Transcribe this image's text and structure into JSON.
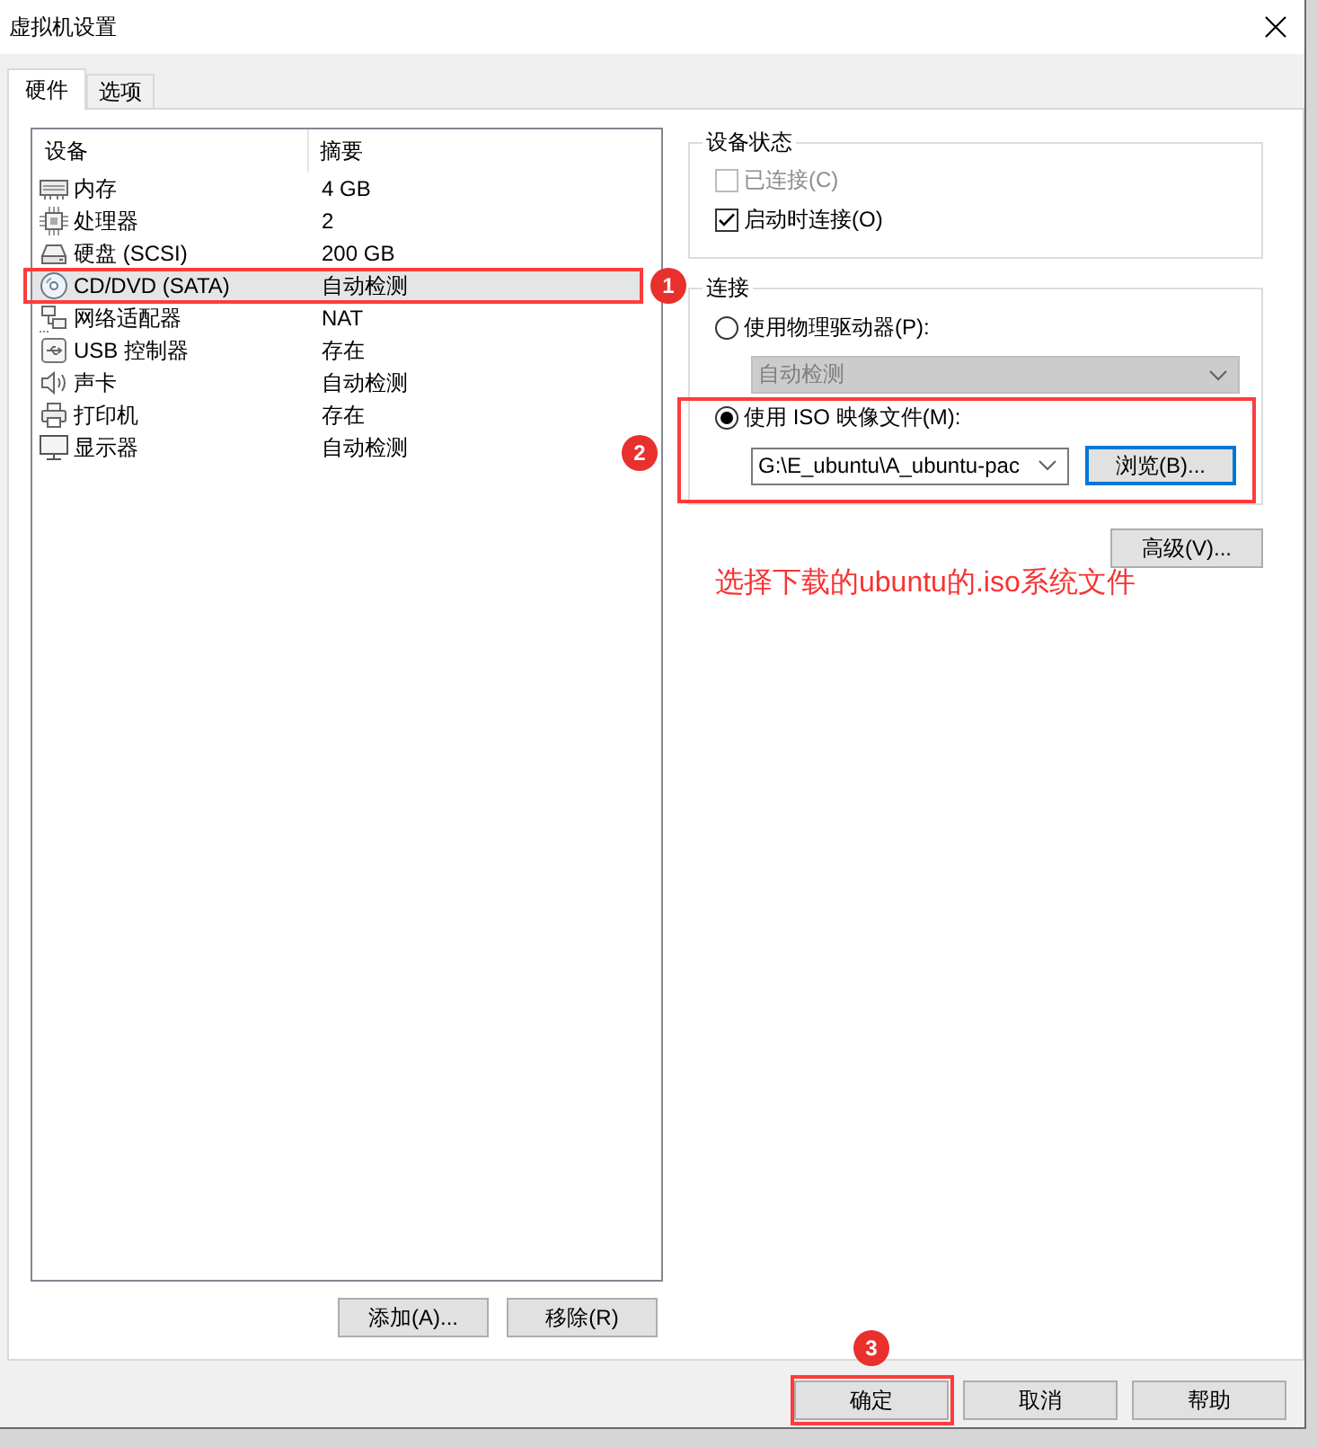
{
  "window": {
    "title": "虚拟机设置"
  },
  "tabs": [
    {
      "label": "硬件",
      "selected": true
    },
    {
      "label": "选项",
      "selected": false
    }
  ],
  "device_list": {
    "columns": [
      "设备",
      "摘要"
    ],
    "rows": [
      {
        "kind": "memory",
        "device": "内存",
        "summary": "4 GB",
        "selected": false
      },
      {
        "kind": "processor",
        "device": "处理器",
        "summary": "2",
        "selected": false
      },
      {
        "kind": "hard_disk",
        "device": "硬盘 (SCSI)",
        "summary": "200 GB",
        "selected": false
      },
      {
        "kind": "cd_dvd",
        "device": "CD/DVD (SATA)",
        "summary": "自动检测",
        "selected": true,
        "step": "1"
      },
      {
        "kind": "network",
        "device": "网络适配器",
        "summary": "NAT",
        "selected": false
      },
      {
        "kind": "usb",
        "device": "USB 控制器",
        "summary": "存在",
        "selected": false
      },
      {
        "kind": "sound",
        "device": "声卡",
        "summary": "自动检测",
        "selected": false
      },
      {
        "kind": "printer",
        "device": "打印机",
        "summary": "存在",
        "selected": false
      },
      {
        "kind": "display",
        "device": "显示器",
        "summary": "自动检测",
        "selected": false
      }
    ]
  },
  "list_buttons": [
    {
      "label": "添加(A)..."
    },
    {
      "label": "移除(R)"
    }
  ],
  "device_status": {
    "title": "设备状态",
    "options": [
      {
        "label": "已连接(C)",
        "checked": false,
        "disabled": true
      },
      {
        "label": "启动时连接(O)",
        "checked": true,
        "disabled": false
      }
    ]
  },
  "connection": {
    "title": "连接",
    "physical_drive": {
      "label": "使用物理驱动器(P):",
      "selected": false,
      "dropdown": {
        "value": "自动检测",
        "disabled": true
      }
    },
    "iso_image": {
      "label": "使用 ISO 映像文件(M):",
      "selected": true,
      "path": "G:\\E_ubuntu\\A_ubuntu-pac",
      "browse_button": {
        "label": "浏览(B)...",
        "focused": true
      },
      "step": "2"
    }
  },
  "advanced_button": {
    "label": "高级(V)..."
  },
  "note": "选择下载的ubuntu的.iso系统文件",
  "dialog_buttons": [
    {
      "label": "确定",
      "step": "3"
    },
    {
      "label": "取消"
    },
    {
      "label": "帮助"
    }
  ]
}
